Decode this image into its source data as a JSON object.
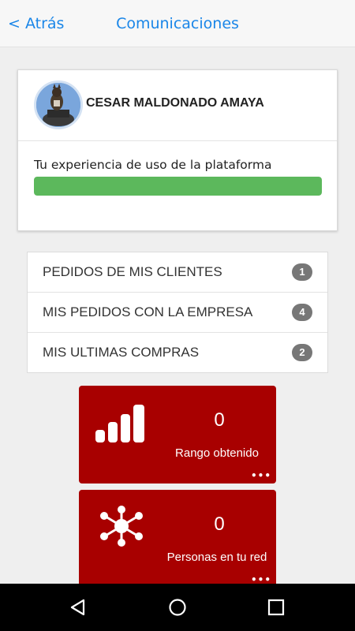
{
  "header": {
    "back_label": "< Atrás",
    "title": "Comunicaciones"
  },
  "profile": {
    "name": "CESAR MALDONADO AMAYA",
    "experience_label": "Tu experiencia de uso de la plataforma",
    "experience_progress": 1.0
  },
  "orders": [
    {
      "label": "PEDIDOS DE MIS CLIENTES",
      "count": "1"
    },
    {
      "label": "MIS PEDIDOS CON LA EMPRESA",
      "count": "4"
    },
    {
      "label": "MIS ULTIMAS COMPRAS",
      "count": "2"
    }
  ],
  "stats": [
    {
      "value": "0",
      "label": "Rango obtenido",
      "icon": "signal-bars-icon",
      "more": "•••"
    },
    {
      "value": "0",
      "label": "Personas en tu red",
      "icon": "network-icon",
      "more": "•••"
    }
  ],
  "colors": {
    "accent": "#1a86e8",
    "tile": "#a80000",
    "progress": "#5cb85c",
    "badge": "#777777"
  },
  "navbar": {
    "icons": [
      "back-triangle-icon",
      "home-circle-icon",
      "recents-square-icon"
    ]
  }
}
